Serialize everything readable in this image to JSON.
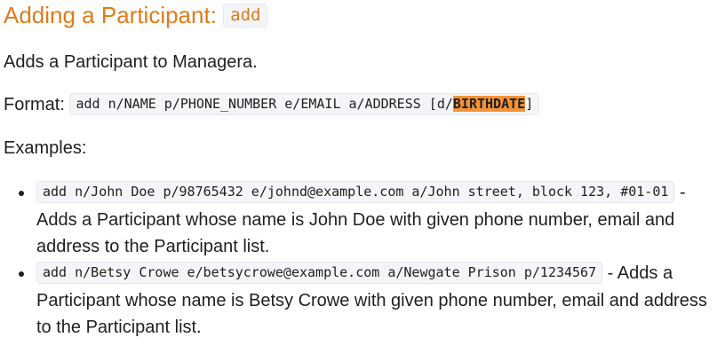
{
  "section": {
    "title": "Adding a Participant: ",
    "command": "add"
  },
  "description": "Adds a Participant to Managera.",
  "format": {
    "label": "Format: ",
    "code_prefix": "add n/NAME p/PHONE_NUMBER e/EMAIL a/ADDRESS [d/",
    "code_highlight": "BIRTHDATE",
    "code_suffix": "]"
  },
  "examples_label": "Examples:",
  "examples": [
    {
      "code": "add n/John Doe p/98765432 e/johnd@example.com a/John street, block 123, #01-01",
      "text": " - Adds a Participant whose name is John Doe with given phone number, email and address to the Participant list."
    },
    {
      "code": "add n/Betsy Crowe e/betsycrowe@example.com a/Newgate Prison p/1234567",
      "text": " - Adds a Participant whose name is Betsy Crowe with given phone number, email and address to the Participant list."
    }
  ],
  "colors": {
    "heading": "#e07b1a",
    "highlight": "#f39237",
    "code_background": "#f3f5f8"
  }
}
